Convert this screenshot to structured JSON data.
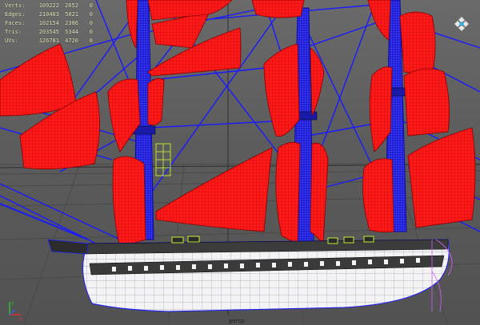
{
  "hud": {
    "rows": [
      {
        "label": "Verts:",
        "total": "109222",
        "selected": "2652",
        "components": "0"
      },
      {
        "label": "Edges:",
        "total": "210403",
        "selected": "5021",
        "components": "0"
      },
      {
        "label": "Faces:",
        "total": "102154",
        "selected": "2386",
        "components": "0"
      },
      {
        "label": "Tris:",
        "total": "203545",
        "selected": "5344",
        "components": "0"
      },
      {
        "label": "UVs:",
        "total": "126781",
        "selected": "4720",
        "components": "0"
      }
    ]
  },
  "camera": {
    "label": "persp"
  },
  "view_cube": {
    "icon": "view-cube-icon"
  },
  "axis_gizmo": {
    "icon": "axis-gizmo-icon",
    "x_color": "#e03030",
    "y_color": "#30c030",
    "z_color": "#3060e0"
  },
  "colors": {
    "viewport_bg": "#5d5d5d",
    "sail_red": "#ff1e1e",
    "rigging_blue": "#1a1aff",
    "hull_white": "#f4f4f4",
    "hull_dark": "#3c3c3c",
    "selection_green": "#ccff33"
  }
}
